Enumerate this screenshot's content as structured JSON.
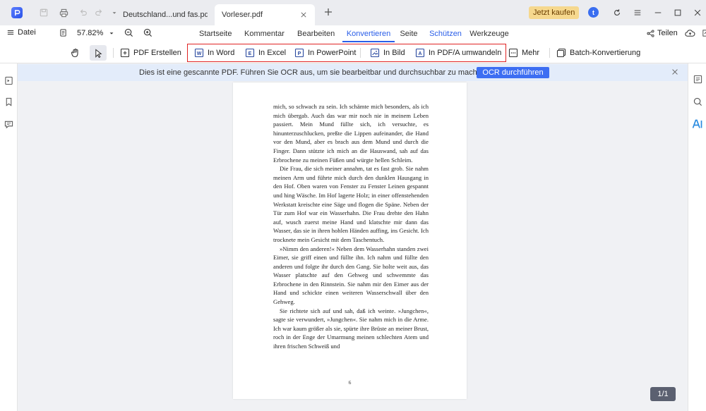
{
  "titlebar": {
    "tabs": [
      {
        "label": "Deutschland...und fas.pdf"
      },
      {
        "label": "Vorleser.pdf"
      }
    ],
    "buy_label": "Jetzt kaufen",
    "avatar_letter": "t"
  },
  "menubar": {
    "file_label": "Datei",
    "zoom_value": "57.82%",
    "tabs": [
      "Startseite",
      "Kommentar",
      "Bearbeiten",
      "Konvertieren",
      "Seite",
      "Schützen",
      "Werkzeuge"
    ],
    "active_tab": "Konvertieren",
    "share_label": "Teilen"
  },
  "toolbar": {
    "pdf_create": "PDF Erstellen",
    "to_word": "In Word",
    "to_excel": "In Excel",
    "to_ppt": "In PowerPoint",
    "to_image": "In Bild",
    "to_pdfa": "In PDF/A umwandeln",
    "more": "Mehr",
    "batch": "Batch-Konvertierung"
  },
  "ocr_banner": {
    "message": "Dies ist eine gescannte PDF. Führen Sie OCR aus, um sie bearbeitbar und durchsuchbar zu machen.",
    "button": "OCR durchführen"
  },
  "document": {
    "paragraphs": [
      "mich, so schwach zu sein. Ich schämte mich besonders, als ich mich übergab. Auch das war mir noch nie in meinem Leben passiert. Mein Mund füllte sich, ich versuchte, es hinunterzuschlucken, preßte die Lippen aufeinander, die Hand vor den Mund, aber es brach aus dem Mund und durch die Finger. Dann stützte ich mich an die Hauswand, sah auf das Erbrochene zu meinen Füßen und würgte hellen Schleim.",
      "Die Frau, die sich meiner annahm, tat es fast grob. Sie nahm meinen Arm und führte mich durch den dunklen Hausgang in den Hof. Oben waren von Fenster zu Fenster Leinen gespannt und hing Wäsche. Im Hof lagerte Holz; in einer offenstehenden Werkstatt kreischte eine Säge und flogen die Späne. Neben der Tür zum Hof war ein Wasserhahn. Die Frau drehte den Hahn auf, wusch zuerst meine Hand und klatschte mir dann das Wasser, das sie in ihren hohlen Händen auffing, ins Gesicht. Ich trocknete mein Gesicht mit dem Taschentuch.",
      "»Nimm den anderen!« Neben dem Wasserhahn standen zwei Eimer, sie griff einen und füllte ihn. Ich nahm und füllte den anderen und folgte ihr durch den Gang. Sie holte weit aus, das Wasser platschte auf den Gehweg und schwemmte das Erbrochene in den Rinnstein. Sie nahm mir den Eimer aus der Hand und schickte einen weiteren Wasserschwall über den Gehweg.",
      "Sie richtete sich auf und sah, daß ich weinte. »Jungchen«, sagte sie verwundert, »Jungchen«. Sie nahm mich in die Arme. Ich war kaum größer als sie, spürte ihre Brüste an meiner Brust, roch in der Enge der Umarmung meinen schlechten Atem und ihren frischen Schweiß und"
    ],
    "page_number": "6"
  },
  "page_counter": "1/1"
}
